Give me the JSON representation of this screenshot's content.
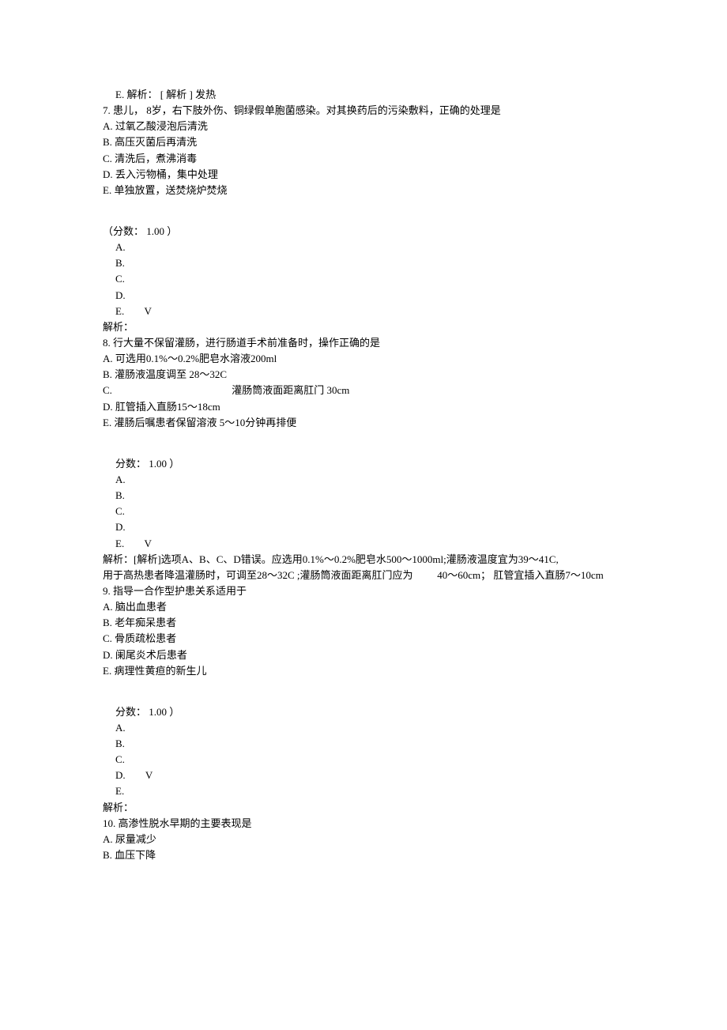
{
  "q6": {
    "optionE": "E.  解析： [ 解析 ] 发热"
  },
  "q7": {
    "stem": "7.    患儿， 8岁，右下肢外伤、铜绿假单胞菌感染。对其换药后的污染敷料，正确的处理是",
    "optA": "A.  过氧乙酸浸泡后清洗",
    "optB": "B.  高压灭菌后再清洗",
    "optC": "C.  清洗后，煮沸消毒",
    "optD": "D.  丢入污物桶，集中处理",
    "optE": "E.  单独放置，送焚烧炉焚烧",
    "score": "（分数： 1.00 ）",
    "ansA": "A.",
    "ansB": "B.",
    "ansC": "C.",
    "ansD": "D.",
    "ansE": "E.",
    "checkE": "V",
    "explain": "解析："
  },
  "q8": {
    "stem": "8.  行大量不保留灌肠，进行肠道手术前准备时，操作正确的是",
    "optA": "A.  可选用0.1%～0.2%肥皂水溶液200ml",
    "optB": "B.  灌肠液温度调至 28～32C",
    "optC_left": "C.",
    "optC_right": "灌肠筒液面距离肛门    30cm",
    "optD": "D.  肛管插入直肠15～18cm",
    "optE": "E.  灌肠后嘱患者保留溶液 5～10分钟再排便",
    "score": "分数： 1.00 ）",
    "ansA": "A.",
    "ansB": "B.",
    "ansC": "C.",
    "ansD": "D.",
    "ansE": "E.",
    "checkE": "V",
    "explain1": "解析：[解析]选项A、B、C、D错误。应选用0.1%～0.2%肥皂水500～1000ml;灌肠液温度宜为39～41C,",
    "explain2_a": "用于高热患者降温灌肠时，可调至28～32C ;灌肠筒液面距离肛门应为",
    "explain2_b": "40～60cm； 肛管宜插入直肠7～10cm"
  },
  "q9": {
    "stem": "9.  指导一合作型护患关系适用于",
    "optA": "A.  脑出血患者",
    "optB": "B.  老年痴呆患者",
    "optC": "C.  骨质疏松患者",
    "optD": "D.  阑尾炎术后患者",
    "optE": "E.  病理性黄疸的新生儿",
    "score": "分数： 1.00 ）",
    "ansA": "A.",
    "ansB": "B.",
    "ansC": "C.",
    "ansD": "D.",
    "checkD": "V",
    "ansE": "E.",
    "explain": "解析："
  },
  "q10": {
    "stem": "10.  高渗性脱水早期的主要表现是",
    "optA": "A.  尿量减少",
    "optB": "B.  血压下降"
  }
}
